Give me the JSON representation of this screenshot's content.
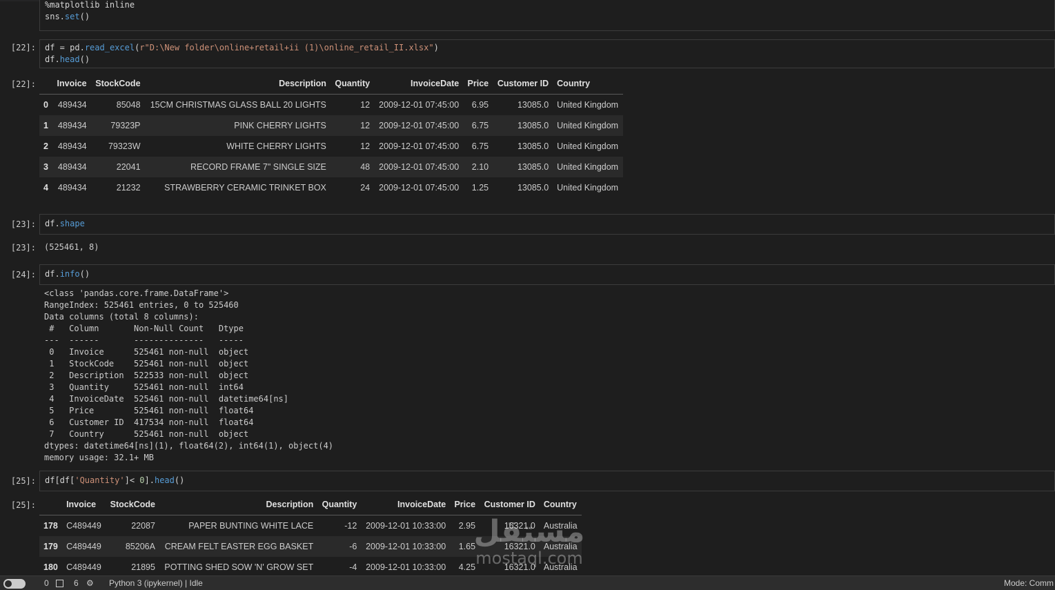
{
  "cell_top": {
    "lines": [
      "%matplotlib inline",
      "sns.set()"
    ]
  },
  "cell22": {
    "prompt_in": "[22]:",
    "code_df": "df",
    "code_eq": " = ",
    "code_pd": "pd.",
    "code_fn": "read_excel",
    "code_open": "(",
    "code_str": "r\"D:\\New folder\\online+retail+ii (1)\\online_retail_II.xlsx\"",
    "code_close": ")",
    "line2_obj": "df.",
    "line2_fn": "head",
    "line2_paren": "()",
    "prompt_out": "[22]:",
    "table": {
      "headers": [
        "",
        "Invoice",
        "StockCode",
        "Description",
        "Quantity",
        "InvoiceDate",
        "Price",
        "Customer ID",
        "Country"
      ],
      "rows": [
        [
          "0",
          "489434",
          "85048",
          "15CM CHRISTMAS GLASS BALL 20 LIGHTS",
          "12",
          "2009-12-01 07:45:00",
          "6.95",
          "13085.0",
          "United Kingdom"
        ],
        [
          "1",
          "489434",
          "79323P",
          "PINK CHERRY LIGHTS",
          "12",
          "2009-12-01 07:45:00",
          "6.75",
          "13085.0",
          "United Kingdom"
        ],
        [
          "2",
          "489434",
          "79323W",
          "WHITE CHERRY LIGHTS",
          "12",
          "2009-12-01 07:45:00",
          "6.75",
          "13085.0",
          "United Kingdom"
        ],
        [
          "3",
          "489434",
          "22041",
          "RECORD FRAME 7\" SINGLE SIZE",
          "48",
          "2009-12-01 07:45:00",
          "2.10",
          "13085.0",
          "United Kingdom"
        ],
        [
          "4",
          "489434",
          "21232",
          "STRAWBERRY CERAMIC TRINKET BOX",
          "24",
          "2009-12-01 07:45:00",
          "1.25",
          "13085.0",
          "United Kingdom"
        ]
      ]
    }
  },
  "cell23": {
    "prompt_in": "[23]:",
    "code_obj": "df.",
    "code_attr": "shape",
    "prompt_out": "[23]:",
    "output": "(525461, 8)"
  },
  "cell24": {
    "prompt_in": "[24]:",
    "code_obj": "df.",
    "code_fn": "info",
    "code_paren": "()",
    "output": "<class 'pandas.core.frame.DataFrame'>\nRangeIndex: 525461 entries, 0 to 525460\nData columns (total 8 columns):\n #   Column       Non-Null Count   Dtype         \n---  ------       --------------   -----         \n 0   Invoice      525461 non-null  object        \n 1   StockCode    525461 non-null  object        \n 2   Description  522533 non-null  object        \n 3   Quantity     525461 non-null  int64         \n 4   InvoiceDate  525461 non-null  datetime64[ns]\n 5   Price        525461 non-null  float64       \n 6   Customer ID  417534 non-null  float64       \n 7   Country      525461 non-null  object        \ndtypes: datetime64[ns](1), float64(2), int64(1), object(4)\nmemory usage: 32.1+ MB"
  },
  "cell25": {
    "prompt_in": "[25]:",
    "code_a": "df[df[",
    "code_str": "'Quantity'",
    "code_b": "]",
    "code_op": "< ",
    "code_num": "0",
    "code_c": "].",
    "code_fn": "head",
    "code_d": "()",
    "prompt_out": "[25]:",
    "table": {
      "headers": [
        "",
        "Invoice",
        "StockCode",
        "Description",
        "Quantity",
        "InvoiceDate",
        "Price",
        "Customer ID",
        "Country"
      ],
      "rows": [
        [
          "178",
          "C489449",
          "22087",
          "PAPER BUNTING WHITE LACE",
          "-12",
          "2009-12-01 10:33:00",
          "2.95",
          "16321.0",
          "Australia"
        ],
        [
          "179",
          "C489449",
          "85206A",
          "CREAM FELT EASTER EGG BASKET",
          "-6",
          "2009-12-01 10:33:00",
          "1.65",
          "16321.0",
          "Australia"
        ],
        [
          "180",
          "C489449",
          "21895",
          "POTTING SHED SOW 'N' GROW SET",
          "-4",
          "2009-12-01 10:33:00",
          "4.25",
          "16321.0",
          "Australia"
        ]
      ]
    }
  },
  "statusbar": {
    "count_a": "0",
    "count_b": "6",
    "kernel": "Python 3 (ipykernel) | Idle",
    "mode": "Mode: Comm"
  },
  "watermark": {
    "arabic": "مستقل",
    "latin": "mostaql.com"
  }
}
